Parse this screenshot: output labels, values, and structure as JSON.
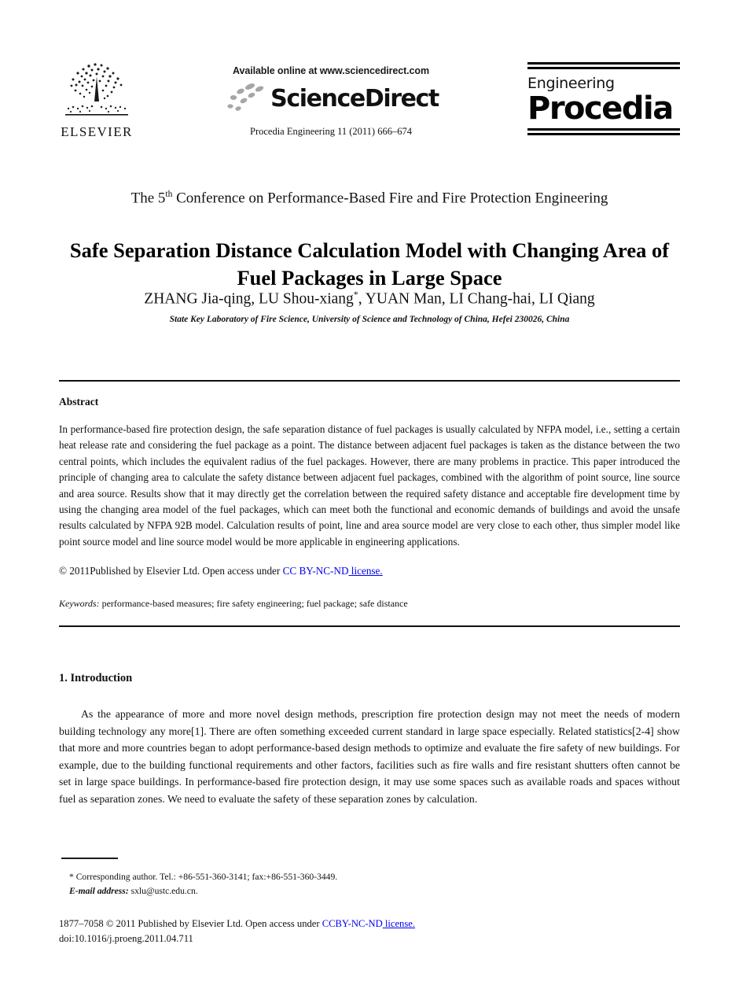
{
  "masthead": {
    "elsevier": {
      "wordmark": "ELSEVIER",
      "tree_icon": "elsevier-tree-icon"
    },
    "sciencedirect": {
      "available_line": "Available online at www.sciencedirect.com",
      "brand": "ScienceDirect",
      "citation": "Procedia Engineering 11 (2011) 666–674"
    },
    "procedia": {
      "line1": "Engineering",
      "line2": "Procedia"
    }
  },
  "conference": {
    "prefix": "The 5",
    "ordinal": "th",
    "suffix": " Conference on Performance-Based Fire and Fire Protection Engineering"
  },
  "title": "Safe Separation Distance Calculation Model with Changing Area of Fuel Packages in Large Space",
  "authors": {
    "part1": "ZHANG Jia-qing, LU Shou-xiang",
    "marker": "*",
    "part2": ", YUAN Man, LI Chang-hai, LI Qiang"
  },
  "affiliation": "State Key Laboratory of Fire Science, University of Science and Technology of China, Hefei 230026, China",
  "abstract": {
    "heading": "Abstract",
    "body": "In performance-based fire protection design, the safe separation distance of fuel packages is usually calculated by NFPA model, i.e., setting a certain heat release rate and considering the fuel package as a point. The distance between adjacent fuel packages is taken as the distance between the two central points, which includes the equivalent radius of the fuel packages. However, there are many problems in practice. This paper introduced the principle of changing area to calculate the safety distance between adjacent fuel packages, combined with the algorithm of point source, line source and area source. Results show that it may directly get the correlation between the required safety distance and acceptable fire development time by using the changing area model of the fuel packages, which can meet both the functional and economic demands of buildings and avoid the unsafe results calculated by NFPA 92B model. Calculation results of point, line and area source model are very close to each other, thus simpler model like point source model and line source model would be more applicable in engineering applications."
  },
  "copyright": {
    "text": "© 2011Published by Elsevier Ltd. Open access under ",
    "link_label": "CC BY-NC-ND",
    "link_suffix": "license.",
    "link_color": "#0000ee"
  },
  "keywords": {
    "label": "Keywords:",
    "value": " performance-based measures; fire safety engineering; fuel package; safe distance"
  },
  "introduction": {
    "heading": "1. Introduction",
    "body": "As the appearance of more and more novel design methods, prescription fire protection design may not meet the needs of modern building technology any more[1]. There are often something exceeded current standard in large space especially. Related statistics[2-4] show that more and more countries began to adopt performance-based design methods to optimize and evaluate the fire safety of new buildings. For example, due to the building functional requirements and other factors, facilities such as fire walls and fire resistant shutters often cannot be set in large space buildings. In performance-based fire protection design, it may use some spaces such as available roads and spaces without fuel as separation zones. We need to evaluate the safety of these separation zones by calculation."
  },
  "footnote": {
    "corresponding": "* Corresponding author. Tel.: +86-551-360-3141; fax:+86-551-360-3449.",
    "email_label": "E-mail address:",
    "email_value": " sxlu@ustc.edu.cn."
  },
  "footer": {
    "issn_prefix": "1877–7058 © 2011 Published by Elsevier Ltd. Open access under ",
    "issn_link": "CCBY-NC-ND",
    "issn_link_suffix": "license.",
    "doi": "doi:10.1016/j.proeng.2011.04.711"
  }
}
